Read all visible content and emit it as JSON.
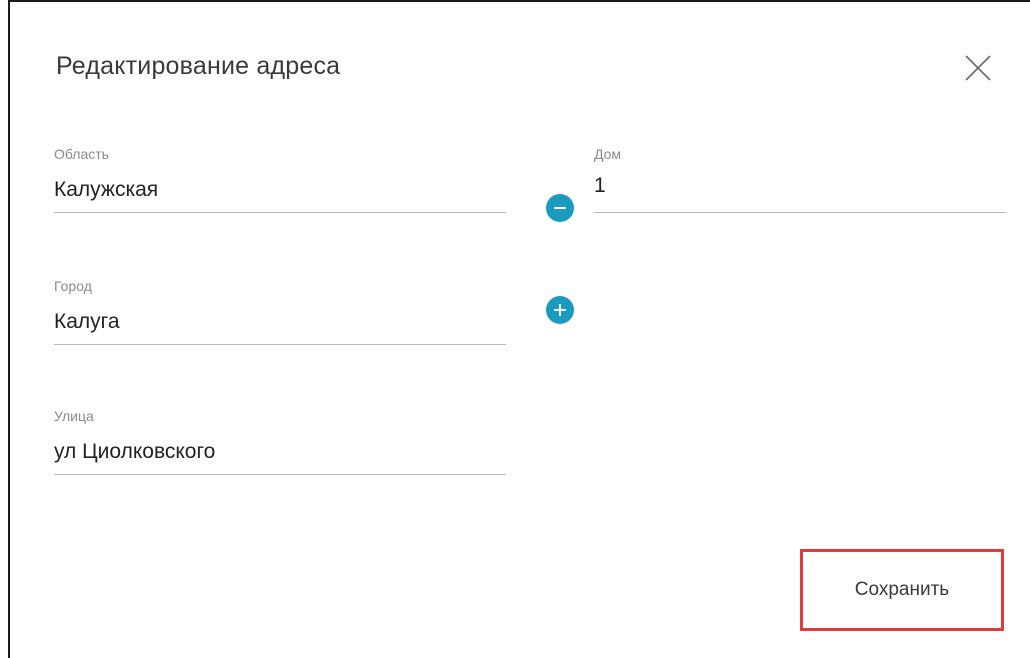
{
  "dialog": {
    "title": "Редактирование адреса",
    "close_icon": "close-icon"
  },
  "fields": {
    "region": {
      "label": "Область",
      "value": "Калужская"
    },
    "house": {
      "label": "Дом",
      "value": "1"
    },
    "city": {
      "label": "Город",
      "value": "Калуга"
    },
    "street": {
      "label": "Улица",
      "value": "ул Циолковского"
    }
  },
  "buttons": {
    "remove_icon": "minus-circle-icon",
    "add_icon": "plus-circle-icon",
    "save_label": "Сохранить"
  },
  "colors": {
    "accent": "#1a9bbd",
    "highlight": "#e03a3a"
  }
}
